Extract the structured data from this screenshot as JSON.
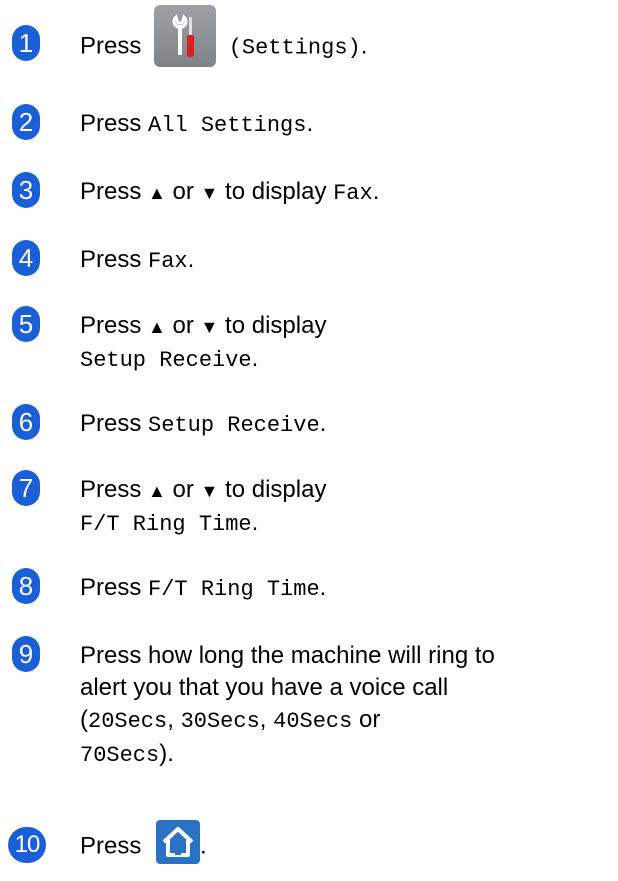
{
  "steps": [
    {
      "num": "1",
      "pre": "Press",
      "mono": "(Settings)",
      "post": "."
    },
    {
      "num": "2",
      "pre": "Press",
      "mono": "All Settings",
      "post": "."
    },
    {
      "num": "3",
      "pre": "Press",
      "up": "▲",
      "or": "or",
      "down": "▼",
      "mid": "to display",
      "mono": "Fax",
      "post": "."
    },
    {
      "num": "4",
      "pre": "Press",
      "mono": "Fax",
      "post": "."
    },
    {
      "num": "5",
      "pre": "Press",
      "up": "▲",
      "or": "or",
      "down": "▼",
      "mid": "to display",
      "mono": "Setup Receive",
      "post": "."
    },
    {
      "num": "6",
      "pre": "Press",
      "mono": "Setup Receive",
      "post": "."
    },
    {
      "num": "7",
      "pre": "Press",
      "up": "▲",
      "or": "or",
      "down": "▼",
      "mid": "to display",
      "mono": "F/T Ring Time",
      "post": "."
    },
    {
      "num": "8",
      "pre": "Press",
      "mono": "F/T Ring Time",
      "post": "."
    },
    {
      "num": "9",
      "line1": "Press how long the machine will ring to",
      "line2": "alert you that you have a voice call",
      "open": "(",
      "opt1": "20Secs",
      "sep1": ",",
      "opt2": "30Secs",
      "sep2": ",",
      "opt3": "40Secs",
      "or": "or",
      "opt4": "70Secs",
      "close": ")."
    },
    {
      "num": "10",
      "pre": "Press",
      "post": "."
    }
  ],
  "icons": {
    "settings": "settings-wrench-screwdriver-icon",
    "home": "home-icon"
  },
  "colors": {
    "badge": "#1a5fd6",
    "settings_bg": "#8a8e92",
    "home_bg": "#2a73c4"
  }
}
